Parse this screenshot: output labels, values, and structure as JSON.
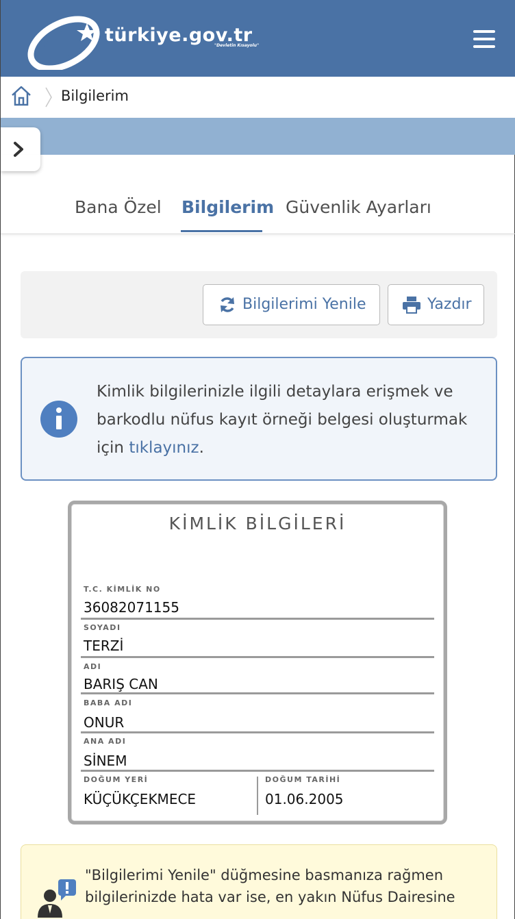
{
  "header": {
    "logo_text": "türkiye.gov.tr",
    "logo_slogan": "\"Devletin Kısayolu\"",
    "menu_icon": "hamburger-menu-icon"
  },
  "breadcrumb": {
    "home_icon": "home-icon",
    "current": "Bilgilerim"
  },
  "tabs": [
    {
      "label": "Bana Özel",
      "active": false
    },
    {
      "label": "Bilgilerim",
      "active": true
    },
    {
      "label": "Güvenlik Ayarları",
      "active": false
    }
  ],
  "toolbar": {
    "refresh_label": "Bilgilerimi Yenile",
    "refresh_icon": "refresh-icon",
    "print_label": "Yazdır",
    "print_icon": "printer-icon"
  },
  "info": {
    "icon": "info-icon",
    "text_before_link": "Kimlik bilgilerinizle ilgili detaylara erişmek ve barkodlu nüfus kayıt örneği belgesi oluşturmak için ",
    "link_text": "tıklayınız",
    "text_after_link": "."
  },
  "id_card": {
    "title": "KİMLİK BİLGİLERİ",
    "tc_label": "T.C. KİMLİK NO",
    "tc_value": "36082071155",
    "surname_label": "SOYADI",
    "surname_value": "TERZİ",
    "name_label": "ADI",
    "name_value": "BARIŞ CAN",
    "father_label": "BABA ADI",
    "father_value": "ONUR",
    "mother_label": "ANA ADI",
    "mother_value": "SİNEM",
    "birthplace_label": "DOĞUM YERİ",
    "birthplace_value": "KÜÇÜKÇEKMECE",
    "birthdate_label": "DOĞUM TARİHİ",
    "birthdate_value": "01.06.2005"
  },
  "warning": {
    "icon": "user-alert-icon",
    "text": "\"Bilgilerimi Yenile\" düğmesine basmanıza rağmen bilgilerinizde hata var ise, en yakın Nüfus Dairesine"
  },
  "colors": {
    "header_bg": "#4a72a5",
    "strip_bg": "#91b1d2",
    "accent": "#4a72a5",
    "info_bg": "#f1f5fa",
    "warning_bg": "#fffadb"
  }
}
